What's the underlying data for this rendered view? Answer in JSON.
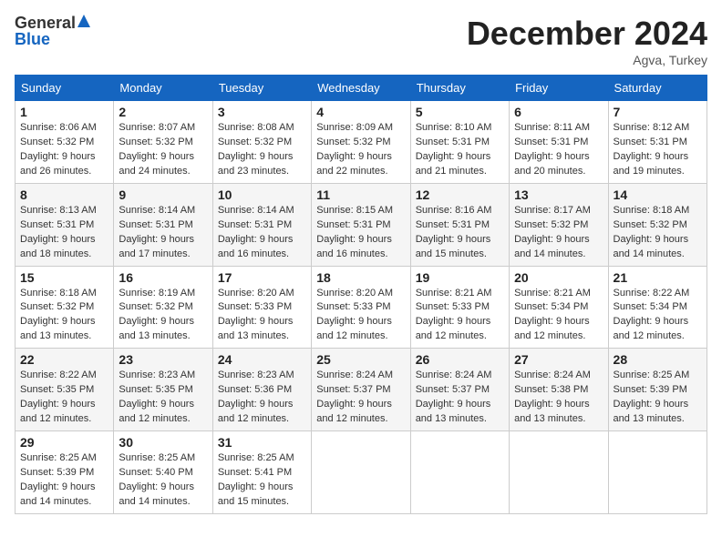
{
  "header": {
    "logo_general": "General",
    "logo_blue": "Blue",
    "month_title": "December 2024",
    "location": "Agva, Turkey"
  },
  "weekdays": [
    "Sunday",
    "Monday",
    "Tuesday",
    "Wednesday",
    "Thursday",
    "Friday",
    "Saturday"
  ],
  "weeks": [
    [
      {
        "day": "1",
        "sunrise": "8:06 AM",
        "sunset": "5:32 PM",
        "daylight": "9 hours and 26 minutes."
      },
      {
        "day": "2",
        "sunrise": "8:07 AM",
        "sunset": "5:32 PM",
        "daylight": "9 hours and 24 minutes."
      },
      {
        "day": "3",
        "sunrise": "8:08 AM",
        "sunset": "5:32 PM",
        "daylight": "9 hours and 23 minutes."
      },
      {
        "day": "4",
        "sunrise": "8:09 AM",
        "sunset": "5:32 PM",
        "daylight": "9 hours and 22 minutes."
      },
      {
        "day": "5",
        "sunrise": "8:10 AM",
        "sunset": "5:31 PM",
        "daylight": "9 hours and 21 minutes."
      },
      {
        "day": "6",
        "sunrise": "8:11 AM",
        "sunset": "5:31 PM",
        "daylight": "9 hours and 20 minutes."
      },
      {
        "day": "7",
        "sunrise": "8:12 AM",
        "sunset": "5:31 PM",
        "daylight": "9 hours and 19 minutes."
      }
    ],
    [
      {
        "day": "8",
        "sunrise": "8:13 AM",
        "sunset": "5:31 PM",
        "daylight": "9 hours and 18 minutes."
      },
      {
        "day": "9",
        "sunrise": "8:14 AM",
        "sunset": "5:31 PM",
        "daylight": "9 hours and 17 minutes."
      },
      {
        "day": "10",
        "sunrise": "8:14 AM",
        "sunset": "5:31 PM",
        "daylight": "9 hours and 16 minutes."
      },
      {
        "day": "11",
        "sunrise": "8:15 AM",
        "sunset": "5:31 PM",
        "daylight": "9 hours and 16 minutes."
      },
      {
        "day": "12",
        "sunrise": "8:16 AM",
        "sunset": "5:31 PM",
        "daylight": "9 hours and 15 minutes."
      },
      {
        "day": "13",
        "sunrise": "8:17 AM",
        "sunset": "5:32 PM",
        "daylight": "9 hours and 14 minutes."
      },
      {
        "day": "14",
        "sunrise": "8:18 AM",
        "sunset": "5:32 PM",
        "daylight": "9 hours and 14 minutes."
      }
    ],
    [
      {
        "day": "15",
        "sunrise": "8:18 AM",
        "sunset": "5:32 PM",
        "daylight": "9 hours and 13 minutes."
      },
      {
        "day": "16",
        "sunrise": "8:19 AM",
        "sunset": "5:32 PM",
        "daylight": "9 hours and 13 minutes."
      },
      {
        "day": "17",
        "sunrise": "8:20 AM",
        "sunset": "5:33 PM",
        "daylight": "9 hours and 13 minutes."
      },
      {
        "day": "18",
        "sunrise": "8:20 AM",
        "sunset": "5:33 PM",
        "daylight": "9 hours and 12 minutes."
      },
      {
        "day": "19",
        "sunrise": "8:21 AM",
        "sunset": "5:33 PM",
        "daylight": "9 hours and 12 minutes."
      },
      {
        "day": "20",
        "sunrise": "8:21 AM",
        "sunset": "5:34 PM",
        "daylight": "9 hours and 12 minutes."
      },
      {
        "day": "21",
        "sunrise": "8:22 AM",
        "sunset": "5:34 PM",
        "daylight": "9 hours and 12 minutes."
      }
    ],
    [
      {
        "day": "22",
        "sunrise": "8:22 AM",
        "sunset": "5:35 PM",
        "daylight": "9 hours and 12 minutes."
      },
      {
        "day": "23",
        "sunrise": "8:23 AM",
        "sunset": "5:35 PM",
        "daylight": "9 hours and 12 minutes."
      },
      {
        "day": "24",
        "sunrise": "8:23 AM",
        "sunset": "5:36 PM",
        "daylight": "9 hours and 12 minutes."
      },
      {
        "day": "25",
        "sunrise": "8:24 AM",
        "sunset": "5:37 PM",
        "daylight": "9 hours and 12 minutes."
      },
      {
        "day": "26",
        "sunrise": "8:24 AM",
        "sunset": "5:37 PM",
        "daylight": "9 hours and 13 minutes."
      },
      {
        "day": "27",
        "sunrise": "8:24 AM",
        "sunset": "5:38 PM",
        "daylight": "9 hours and 13 minutes."
      },
      {
        "day": "28",
        "sunrise": "8:25 AM",
        "sunset": "5:39 PM",
        "daylight": "9 hours and 13 minutes."
      }
    ],
    [
      {
        "day": "29",
        "sunrise": "8:25 AM",
        "sunset": "5:39 PM",
        "daylight": "9 hours and 14 minutes."
      },
      {
        "day": "30",
        "sunrise": "8:25 AM",
        "sunset": "5:40 PM",
        "daylight": "9 hours and 14 minutes."
      },
      {
        "day": "31",
        "sunrise": "8:25 AM",
        "sunset": "5:41 PM",
        "daylight": "9 hours and 15 minutes."
      },
      null,
      null,
      null,
      null
    ]
  ],
  "labels": {
    "sunrise": "Sunrise:",
    "sunset": "Sunset:",
    "daylight": "Daylight:"
  }
}
